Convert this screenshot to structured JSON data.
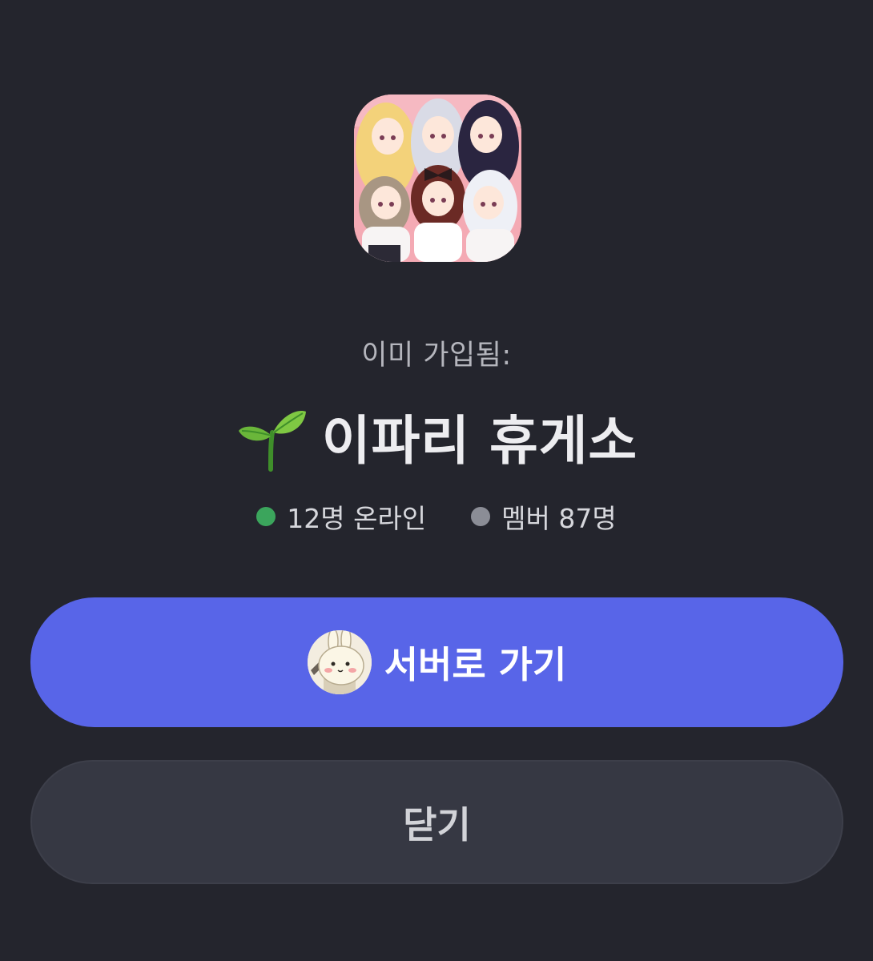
{
  "server": {
    "icon": "server-artwork-icon",
    "already_joined_label": "이미 가입됨:",
    "name_emoji_icon": "sprout-icon",
    "name": "이파리 휴게소"
  },
  "stats": {
    "online_text": "12명 온라인",
    "online_color": "#3ba55c",
    "members_text": "멤버 87명",
    "members_color": "#8b8d96"
  },
  "buttons": {
    "go_to_server_label": "서버로 가기",
    "go_to_server_color": "#5865e8",
    "go_to_server_avatar": "bunny-avatar-icon",
    "close_label": "닫기",
    "close_color": "#363843"
  }
}
